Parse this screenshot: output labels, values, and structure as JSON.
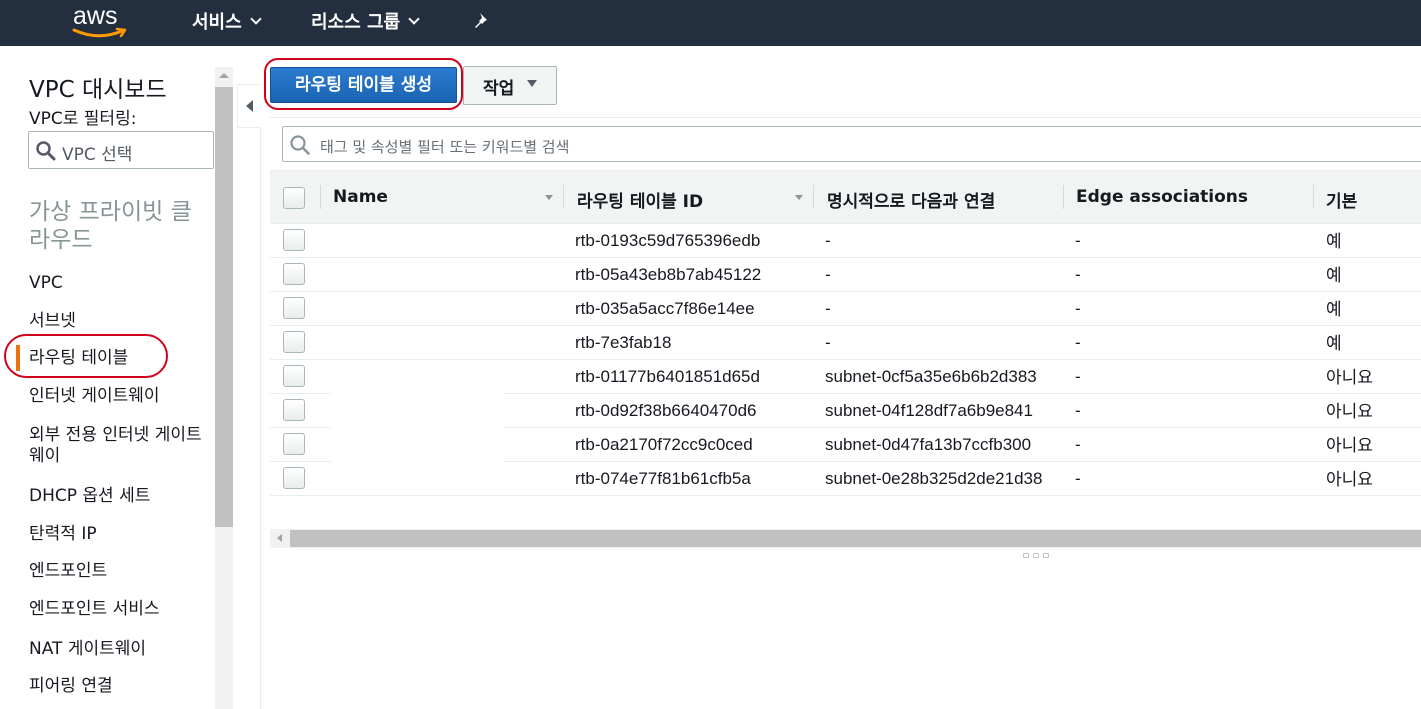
{
  "topnav": {
    "logo": "aws",
    "services": "서비스",
    "resource_groups": "리소스 그룹",
    "pin_icon": "pin-icon"
  },
  "sidebar": {
    "title": "VPC 대시보드",
    "filter_label": "VPC로 필터링:",
    "vpc_select_placeholder": "VPC 선택",
    "section": "가상 프라이빗 클라우드",
    "items": [
      {
        "label": "VPC"
      },
      {
        "label": "서브넷"
      },
      {
        "label": "라우팅 테이블",
        "active": true
      },
      {
        "label": "인터넷 게이트웨이"
      },
      {
        "label": "외부 전용 인터넷 게이트웨이"
      },
      {
        "label": "DHCP 옵션 세트"
      },
      {
        "label": "탄력적 IP"
      },
      {
        "label": "엔드포인트"
      },
      {
        "label": "엔드포인트 서비스"
      },
      {
        "label": "NAT 게이트웨이"
      },
      {
        "label": "피어링 연결"
      }
    ]
  },
  "toolbar": {
    "create_label": "라우팅 테이블 생성",
    "actions_label": "작업"
  },
  "search": {
    "placeholder": "태그 및 속성별 필터 또는 키워드별 검색"
  },
  "table": {
    "columns": [
      "Name",
      "라우팅 테이블 ID",
      "명시적으로 다음과 연결",
      "Edge associations",
      "기본"
    ],
    "rows": [
      {
        "name": "",
        "id": "rtb-0193c59d765396edb",
        "explicit": "-",
        "edge": "-",
        "main": "예"
      },
      {
        "name": "",
        "id": "rtb-05a43eb8b7ab45122",
        "explicit": "-",
        "edge": "-",
        "main": "예"
      },
      {
        "name": "",
        "id": "rtb-035a5acc7f86e14ee",
        "explicit": "-",
        "edge": "-",
        "main": "예"
      },
      {
        "name": "",
        "id": "rtb-7e3fab18",
        "explicit": "-",
        "edge": "-",
        "main": "예"
      },
      {
        "name": "",
        "id": "rtb-01177b6401851d65d",
        "explicit": "subnet-0cf5a35e6b6b2d383",
        "edge": "-",
        "main": "아니요"
      },
      {
        "name": "",
        "id": "rtb-0d92f38b6640470d6",
        "explicit": "subnet-04f128df7a6b9e841",
        "edge": "-",
        "main": "아니요"
      },
      {
        "name": "",
        "id": "rtb-0a2170f72cc9c0ced",
        "explicit": "subnet-0d47fa13b7ccfb300",
        "edge": "-",
        "main": "아니요"
      },
      {
        "name": "",
        "id": "rtb-074e77f81b61cfb5a",
        "explicit": "subnet-0e28b325d2de21d38",
        "edge": "-",
        "main": "아니요"
      }
    ]
  },
  "colors": {
    "nav_bg": "#232f3e",
    "primary": "#1b64b4",
    "active_accent": "#ec7211",
    "highlight_oval": "#d0021b"
  }
}
